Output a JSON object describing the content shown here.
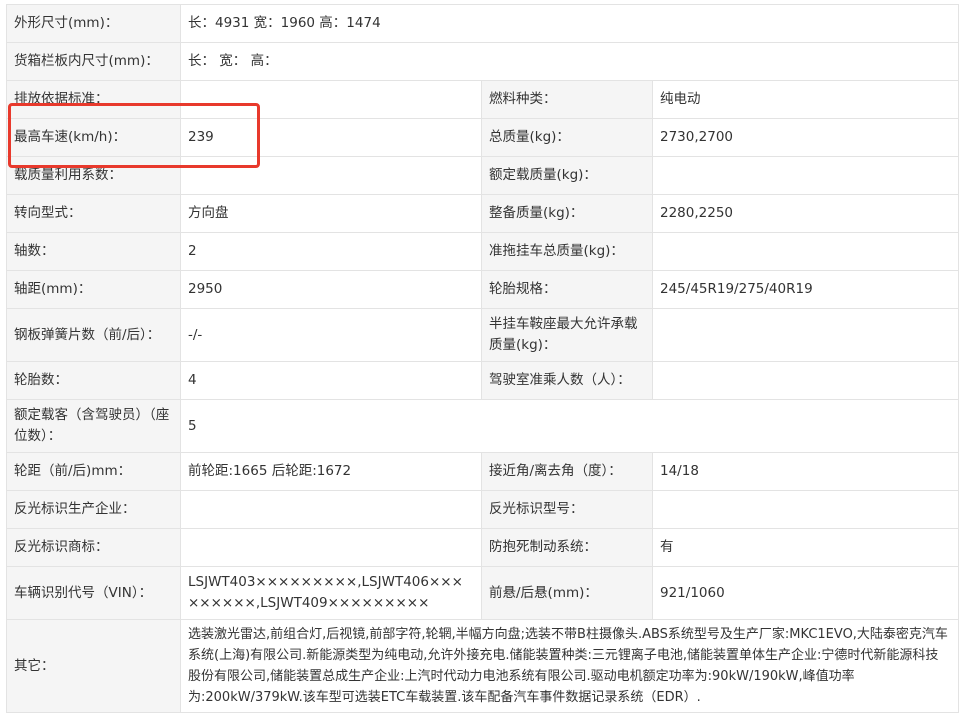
{
  "rows": [
    {
      "l1": "外形尺寸(mm)：",
      "v1": "长：4931 宽：1960 高：1474"
    },
    {
      "l1": "货箱栏板内尺寸(mm)：",
      "v1": "长： 宽： 高："
    },
    {
      "l1": "排放依据标准：",
      "v1": "",
      "l2": "燃料种类：",
      "v2": "纯电动"
    },
    {
      "l1": "最高车速(km/h)：",
      "v1": "239",
      "l2": "总质量(kg)：",
      "v2": "2730,2700"
    },
    {
      "l1": "载质量利用系数：",
      "v1": "",
      "l2": "额定载质量(kg)：",
      "v2": ""
    },
    {
      "l1": "转向型式：",
      "v1": "方向盘",
      "l2": "整备质量(kg)：",
      "v2": "2280,2250"
    },
    {
      "l1": "轴数：",
      "v1": "2",
      "l2": "准拖挂车总质量(kg)：",
      "v2": ""
    },
    {
      "l1": "轴距(mm)：",
      "v1": "2950",
      "l2": "轮胎规格：",
      "v2": "245/45R19/275/40R19"
    },
    {
      "l1": "钢板弹簧片数（前/后）：",
      "v1": "-/-",
      "l2": "半挂车鞍座最大允许承载质量(kg)：",
      "v2": ""
    },
    {
      "l1": "轮胎数：",
      "v1": "4",
      "l2": "驾驶室准乘人数（人）：",
      "v2": ""
    },
    {
      "l1": "额定载客（含驾驶员）（座位数）：",
      "v1": "5"
    },
    {
      "l1": "轮距（前/后)mm：",
      "v1": "前轮距:1665 后轮距:1672",
      "l2": "接近角/离去角（度）：",
      "v2": "14/18"
    },
    {
      "l1": "反光标识生产企业：",
      "v1": "",
      "l2": "反光标识型号：",
      "v2": ""
    },
    {
      "l1": "反光标识商标：",
      "v1": "",
      "l2": "防抱死制动系统：",
      "v2": "有"
    },
    {
      "l1": "车辆识别代号（VIN）：",
      "v1": "LSJWT403×××××××××,LSJWT406×××××××××,LSJWT409×××××××××",
      "l2": "前悬/后悬(mm)：",
      "v2": "921/1060"
    },
    {
      "l1": "其它：",
      "v1": "选装激光雷达,前组合灯,后视镜,前部字符,轮辋,半幅方向盘;选装不带B柱摄像头.ABS系统型号及生产厂家:MKC1EVO,大陆泰密克汽车系统(上海)有限公司.新能源类型为纯电动,允许外接充电.储能装置种类:三元锂离子电池,储能装置单体生产企业:宁德时代新能源科技股份有限公司,储能装置总成生产企业:上汽时代动力电池系统有限公司.驱动电机额定功率为:90kW/190kW,峰值功率为:200kW/379kW.该车型可选装ETC车载装置.该车配备汽车事件数据记录系统（EDR）."
    }
  ],
  "highlight_color": "#e8392c"
}
